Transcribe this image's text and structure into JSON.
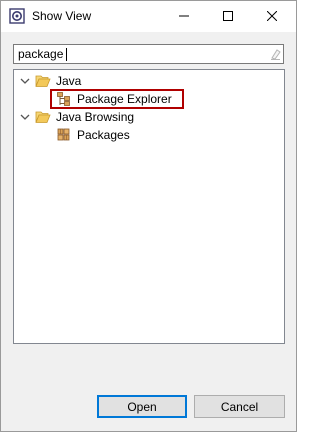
{
  "window": {
    "title": "Show View"
  },
  "filter": {
    "value": "package"
  },
  "tree": {
    "items": [
      {
        "label": "Java",
        "expanded": true,
        "icon": "folder-open-icon",
        "children": [
          {
            "label": "Package Explorer",
            "icon": "package-explorer-icon",
            "selected": true
          }
        ]
      },
      {
        "label": "Java Browsing",
        "expanded": true,
        "icon": "folder-open-icon",
        "children": [
          {
            "label": "Packages",
            "icon": "packages-icon",
            "selected": false
          }
        ]
      }
    ]
  },
  "buttons": {
    "open_label": "Open",
    "cancel_label": "Cancel"
  },
  "colors": {
    "selection_border": "#b00000",
    "default_button_border": "#0078d7",
    "folder": "#e8b84a"
  }
}
